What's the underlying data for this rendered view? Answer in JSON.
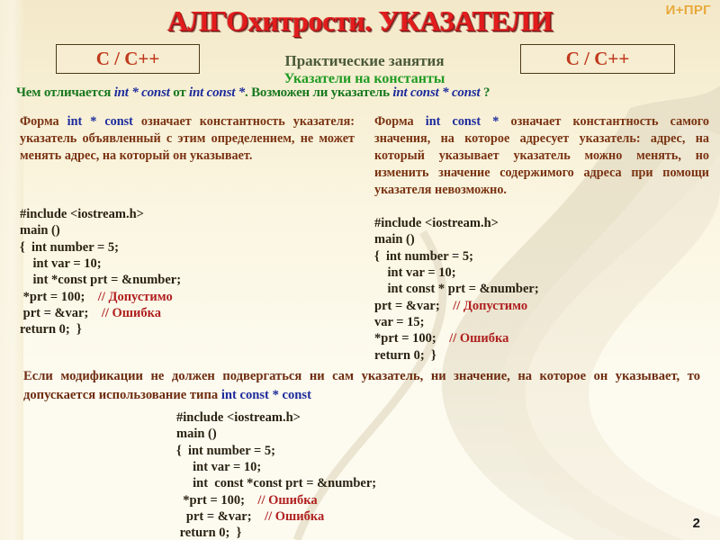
{
  "slide": {
    "corner_tag": "И+ПРГ",
    "title": "АЛГОхитрости. УКАЗАТЕЛИ",
    "lang_box_left": "C / C++",
    "lang_box_right": "C / C++",
    "subtitle_1": "Практические занятия",
    "subtitle_2": "Указатели на константы",
    "page_number": "2",
    "colors": {
      "background": "#fbf6e2",
      "title_red": "#e21c1c",
      "lang_orange": "#c0391c",
      "green_bright": "#1f9b22",
      "green_question": "#18781f",
      "blue_code": "#1d2b9c",
      "brown_text": "#7a3312",
      "comment_red": "#b02020",
      "corner_orange": "#e8a83a"
    }
  },
  "question": {
    "part1": "Чем отличается ",
    "code1": "int * const",
    "part2": "  от  ",
    "code2": "int const *",
    "part3": ".  Возможен ли указатель  ",
    "code3": "int const * const",
    "part4": " ?"
  },
  "left_column": {
    "pre": "Форма  ",
    "keyword": "int * const",
    "post": "  означает константность указателя: указатель объявленный с этим определением, не может менять адрес, на который он указывает."
  },
  "right_column": {
    "pre": "Форма  ",
    "keyword": "int const *",
    "post": "  означает константность самого значения, на которое адресует указатель: адрес, на который указывает указатель можно менять, но изменить значение содержимого адреса при помощи указателя невозможно."
  },
  "code_left": {
    "lines": [
      {
        "text": "#include <iostream.h>",
        "comment": ""
      },
      {
        "text": "main ()",
        "comment": ""
      },
      {
        "text": "{  int number = 5;",
        "comment": ""
      },
      {
        "text": "    int var = 10;",
        "comment": ""
      },
      {
        "text": "    int *const prt = &number;",
        "comment": ""
      },
      {
        "text": " *prt = 100;",
        "comment": "// Допустимо"
      },
      {
        "text": " prt = &var;",
        "comment": "// Ошибка"
      },
      {
        "text": "return 0;  }",
        "comment": ""
      }
    ]
  },
  "code_right": {
    "lines": [
      {
        "text": "#include <iostream.h>",
        "comment": ""
      },
      {
        "text": "main ()",
        "comment": ""
      },
      {
        "text": "{  int number = 5;",
        "comment": ""
      },
      {
        "text": "    int var = 10;",
        "comment": ""
      },
      {
        "text": "    int const * prt = &number;",
        "comment": ""
      },
      {
        "text": "prt = &var;",
        "comment": "// Допустимо"
      },
      {
        "text": "var = 15;",
        "comment": ""
      },
      {
        "text": "*prt = 100;",
        "comment": "// Ошибка"
      },
      {
        "text": "return 0;  }",
        "comment": ""
      }
    ]
  },
  "code_bottom": {
    "lines": [
      {
        "text": "#include <iostream.h>",
        "comment": ""
      },
      {
        "text": "main ()",
        "comment": ""
      },
      {
        "text": "{  int number = 5;",
        "comment": ""
      },
      {
        "text": "     int var = 10;",
        "comment": ""
      },
      {
        "text": "     int  const *const prt = &number;",
        "comment": ""
      },
      {
        "text": "  *prt = 100;",
        "comment": "// Ошибка"
      },
      {
        "text": "   prt = &var;",
        "comment": "// Ошибка"
      },
      {
        "text": " return 0;  }",
        "comment": ""
      }
    ]
  },
  "bottom_paragraph": {
    "pre": "Если модификации не должен подвергаться ни сам указатель, ни значение, на которое он указывает, то допускается использование типа  ",
    "keyword": "int const * const"
  }
}
